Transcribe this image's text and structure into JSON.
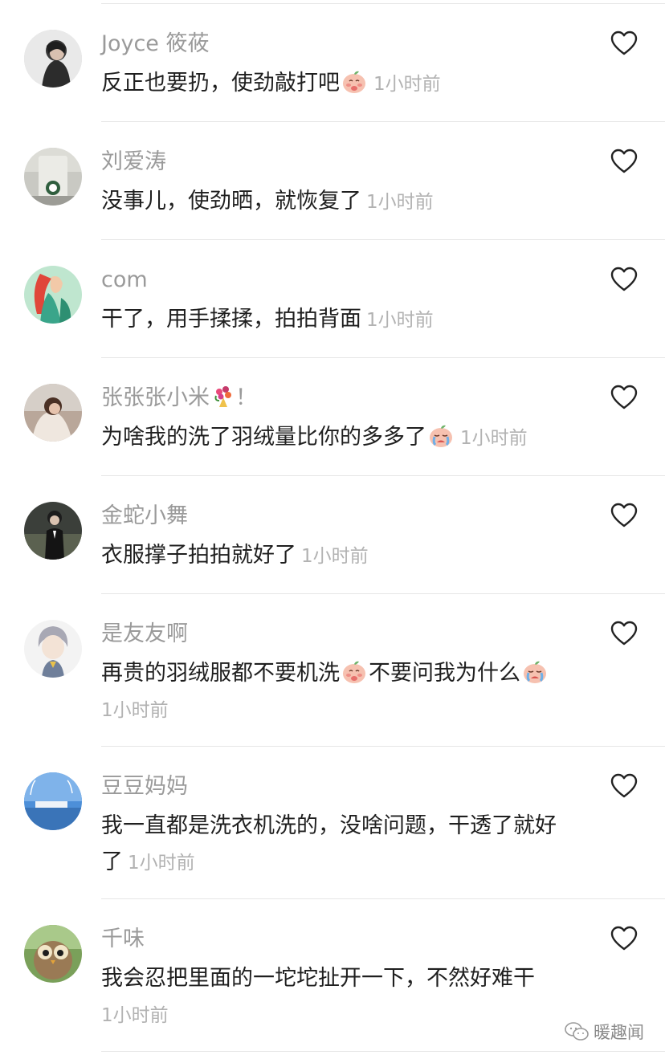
{
  "comments": [
    {
      "user": "Joyce 筱莜",
      "parts": [
        "反正也要扔，使劲敲打吧"
      ],
      "emojis": [
        "blush"
      ],
      "time": "1小时前",
      "time_block": false
    },
    {
      "user": "刘爱涛",
      "parts": [
        "没事儿，使劲晒，就恢复了"
      ],
      "emojis": [],
      "time": "1小时前",
      "time_block": false
    },
    {
      "user": "com",
      "parts": [
        "干了，用手揉揉，拍拍背面"
      ],
      "emojis": [],
      "time": "1小时前",
      "time_block": false
    },
    {
      "user": "张张张小米",
      "user_suffix": "！",
      "user_emoji": "bouquet",
      "parts": [
        "为啥我的洗了羽绒量比你的多多了"
      ],
      "emojis": [
        "cry"
      ],
      "time": "1小时前",
      "time_block": false
    },
    {
      "user": "金蛇小舞",
      "parts": [
        "衣服撑子拍拍就好了"
      ],
      "emojis": [],
      "time": "1小时前",
      "time_block": false
    },
    {
      "user": "是友友啊",
      "parts": [
        "再贵的羽绒服都不要机洗",
        "不要问我为什么"
      ],
      "emojis": [
        "blush",
        "cry"
      ],
      "time": "1小时前",
      "time_block": true
    },
    {
      "user": "豆豆妈妈",
      "parts": [
        "我一直都是洗衣机洗的，没啥问题，干透了就好了"
      ],
      "emojis": [],
      "time": "1小时前",
      "time_block": false
    },
    {
      "user": "千味",
      "parts": [
        "我会忍把里面的一坨坨扯开一下，不然好难干"
      ],
      "emojis": [],
      "time": "1小时前",
      "time_block": true
    }
  ],
  "watermark": {
    "icon": "wechat-icon",
    "text": "暖趣闻"
  },
  "colors": {
    "username": "#9a9a9a",
    "text": "#1f1f1f",
    "time": "#b2b2b2",
    "divider": "#e6e6e6"
  }
}
